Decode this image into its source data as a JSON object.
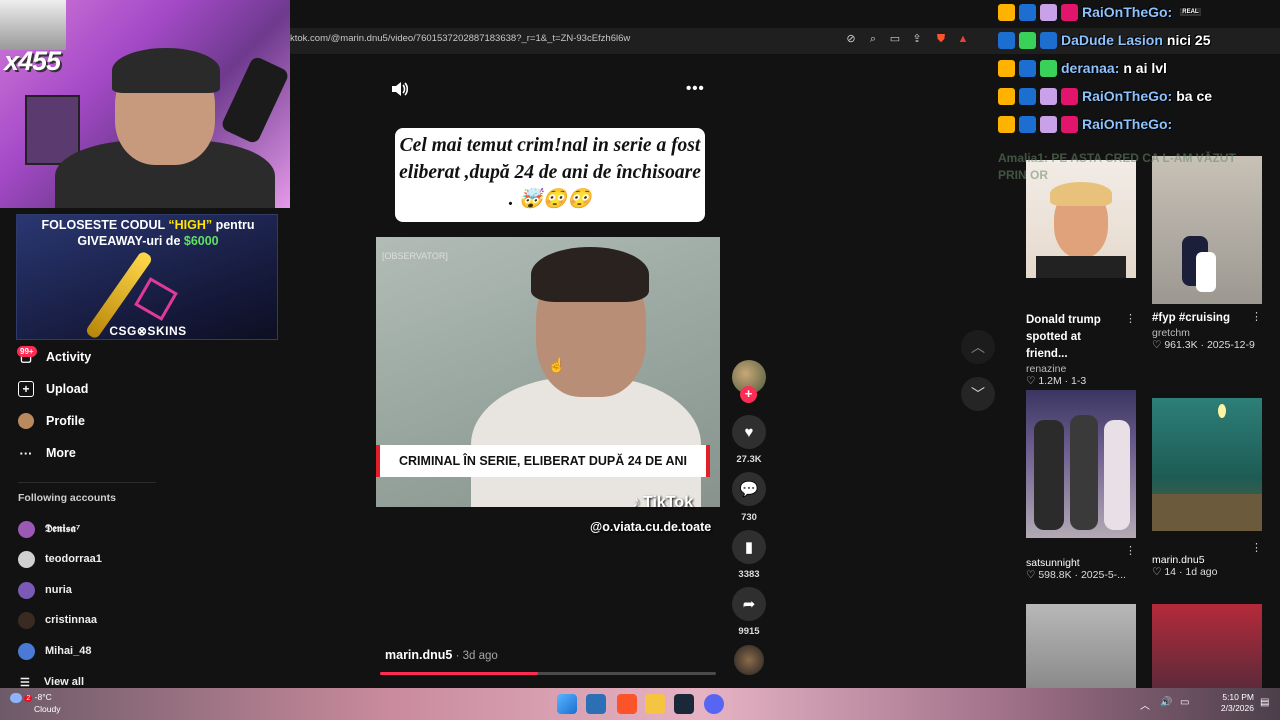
{
  "browser": {
    "url": "ktok.com/@marin.dnu5/video/7601537202887183638?_r=1&_t=ZN-93cEfzh6l6w"
  },
  "stream": {
    "multiplier": "x455",
    "promo": {
      "line1_a": "FOLOSESTE CODUL ",
      "line1_code": "“HIGH”",
      "line1_b": " pentru",
      "line2_a": "GIVEAWAY-uri de ",
      "line2_amount": "$6000",
      "brand": "CSG⊗SKINS"
    }
  },
  "sidebar": {
    "badge": "99+",
    "nav": [
      {
        "label": "Activity",
        "icon": "chat-icon"
      },
      {
        "label": "Upload",
        "icon": "plus-square-icon"
      },
      {
        "label": "Profile",
        "icon": "avatar-icon"
      },
      {
        "label": "More",
        "icon": "more-icon"
      }
    ],
    "following_header": "Following accounts",
    "following": [
      {
        "name": "𝕯𝖊𝖓𝖎𝖘𝖆⁷",
        "color": "#9b59b6"
      },
      {
        "name": "teodorraa1",
        "color": "#d0d0d0"
      },
      {
        "name": "nuria",
        "color": "#7a5ab5"
      },
      {
        "name": "cristinnaa",
        "color": "#3a2a22"
      },
      {
        "name": "Mihai_48",
        "color": "#4a7ad5"
      }
    ],
    "view_all": "View all"
  },
  "video": {
    "caption": "Cel mai temut crim!nal in serie a fost eliberat ,după 24 de ani de închisoare . 🤯😳😳",
    "watermark_top": "[OBSERVATOR]",
    "banner": "CRIMINAL ÎN SERIE, ELIBERAT DUPĂ 24 DE ANI",
    "tiktok_logo": "TikTok",
    "tiktok_handle": "@o.viata.cu.de.toate",
    "author": "marin.dnu5",
    "age": " · 3d ago",
    "progress_fraction": 0.47
  },
  "actions": {
    "likes": "27.3K",
    "comments": "730",
    "saves": "3383",
    "shares": "9915"
  },
  "chat": [
    {
      "name": "RaiOnTheGo:",
      "msg": "",
      "extra": "REAL"
    },
    {
      "name": "DaDude Lasion",
      "msg": "nici 25"
    },
    {
      "name": "deranaa:",
      "msg": "n ai lvl"
    },
    {
      "name": "RaiOnTheGo:",
      "msg": "ba ce"
    },
    {
      "name": "RaiOnTheGo:",
      "msg": ""
    }
  ],
  "chat_faded": "Amalia1: PE ASTA CRED CA L-AM VĂZUT PRIN OR",
  "grid": [
    {
      "caption": "Donald trump spotted at friend...",
      "user": "renazine",
      "views": "1.2M",
      "date": "1-3"
    },
    {
      "caption": "#fyp #cruising",
      "user": "gretchm",
      "views": "961.3K",
      "date": "2025-12-9"
    },
    {
      "caption": "",
      "user": "satsunnight",
      "views": "598.8K",
      "date": "2025-5-..."
    },
    {
      "caption": "",
      "user": "marin.dnu5",
      "views": "14",
      "date": "1d ago"
    },
    {
      "caption": "",
      "user": "",
      "views": "",
      "date": ""
    },
    {
      "caption": "",
      "user": "",
      "views": "",
      "date": ""
    }
  ],
  "taskbar": {
    "temp": "-8°C",
    "cond": "Cloudy",
    "notif": "2",
    "time": "5:10 PM",
    "date": "2/3/2026"
  }
}
